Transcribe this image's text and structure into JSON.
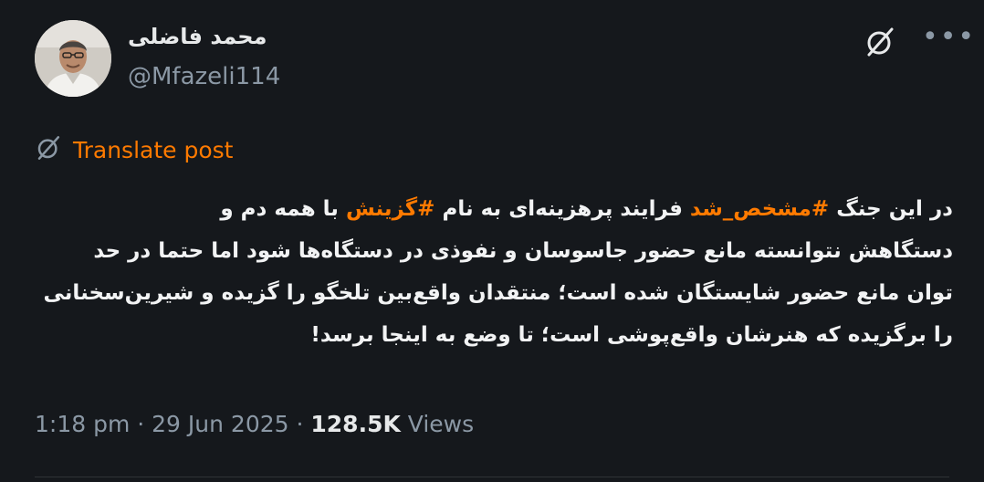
{
  "author": {
    "name": "محمد فاضلی",
    "handle": "@Mfazeli114"
  },
  "icons": {
    "grok": "grok-slash-circle-icon",
    "more": "more-horizontal-icon",
    "translate": "grok-slash-circle-icon"
  },
  "translate_label": "Translate post",
  "post": {
    "line1": {
      "part1": "در این جنگ ",
      "hashtag1": "#مشخص_شد",
      "part2": " فرایند پرهزینه‌ای به نام ",
      "hashtag2": "#گزینش",
      "part3": " با همه دم و"
    },
    "line2": "دستگاهش نتوانسته مانع حضور جاسوسان و نفوذی در دستگاه‌ها شود اما حتما در حد",
    "line3": "توان مانع حضور شایستگان شده است؛ منتقدان واقع‌بین تلخگو را گزیده و شیرین‌سخنانی",
    "line4": "را برگزیده که هنرشان واقع‌پوشی است؛ تا وضع به اینجا برسد!"
  },
  "meta": {
    "time": "1:18 pm",
    "sep1": " · ",
    "date": "29 Jun 2025",
    "sep2": " · ",
    "views_count": "128.5K",
    "views_label": " Views"
  },
  "colors": {
    "background": "#15181c",
    "accent": "#ff7a00",
    "secondary_text": "#8b98a5",
    "primary_text": "#e7e9ea"
  }
}
